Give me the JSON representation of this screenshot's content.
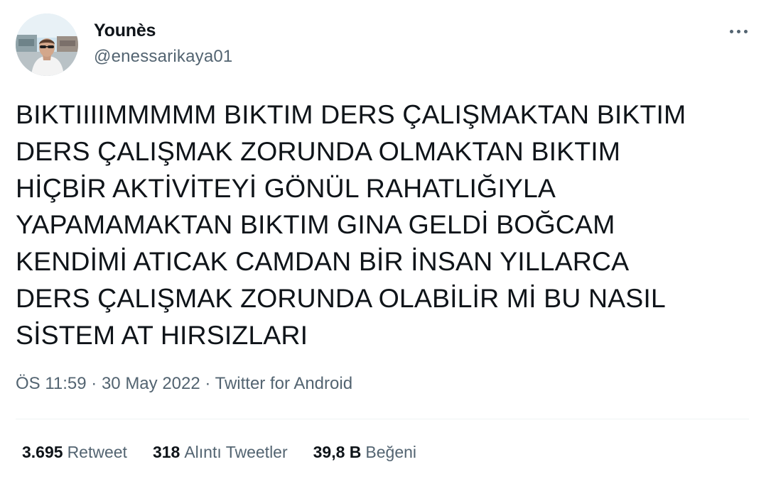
{
  "author": {
    "name": "Younès",
    "handle": "@enessarikaya01"
  },
  "tweet": {
    "lines": [
      "BIKTIIIIMMMMM BIKTIM DERS ÇALIŞMAKTAN BIKTIM",
      "DERS ÇALIŞMAK ZORUNDA OLMAKTAN BIKTIM",
      "HİÇBİR AKTİVİTEYİ GÖNÜL RAHATLIĞIYLA",
      "YAPAMAMAKTAN BIKTIM GINA GELDİ BOĞCAM",
      "KENDİMİ ATICAK CAMDAN BİR İNSAN YILLARCA",
      "DERS ÇALIŞMAK ZORUNDA OLABİLİR Mİ BU NASIL",
      "SİSTEM AT HIRSIZLARI"
    ]
  },
  "meta": {
    "time": "ÖS 11:59",
    "separator": " · ",
    "date": "30 May 2022",
    "source": "Twitter for Android"
  },
  "stats": {
    "retweets": {
      "value": "3.695",
      "label": "Retweet"
    },
    "quotes": {
      "value": "318",
      "label": "Alıntı Tweetler"
    },
    "likes": {
      "value": "39,8 B",
      "label": "Beğeni"
    }
  },
  "icons": {
    "more": "more-options-icon",
    "avatar": "profile-photo"
  },
  "colors": {
    "text": "#0f1419",
    "secondary": "#536471",
    "divider": "#eff3f4",
    "background": "#ffffff"
  }
}
